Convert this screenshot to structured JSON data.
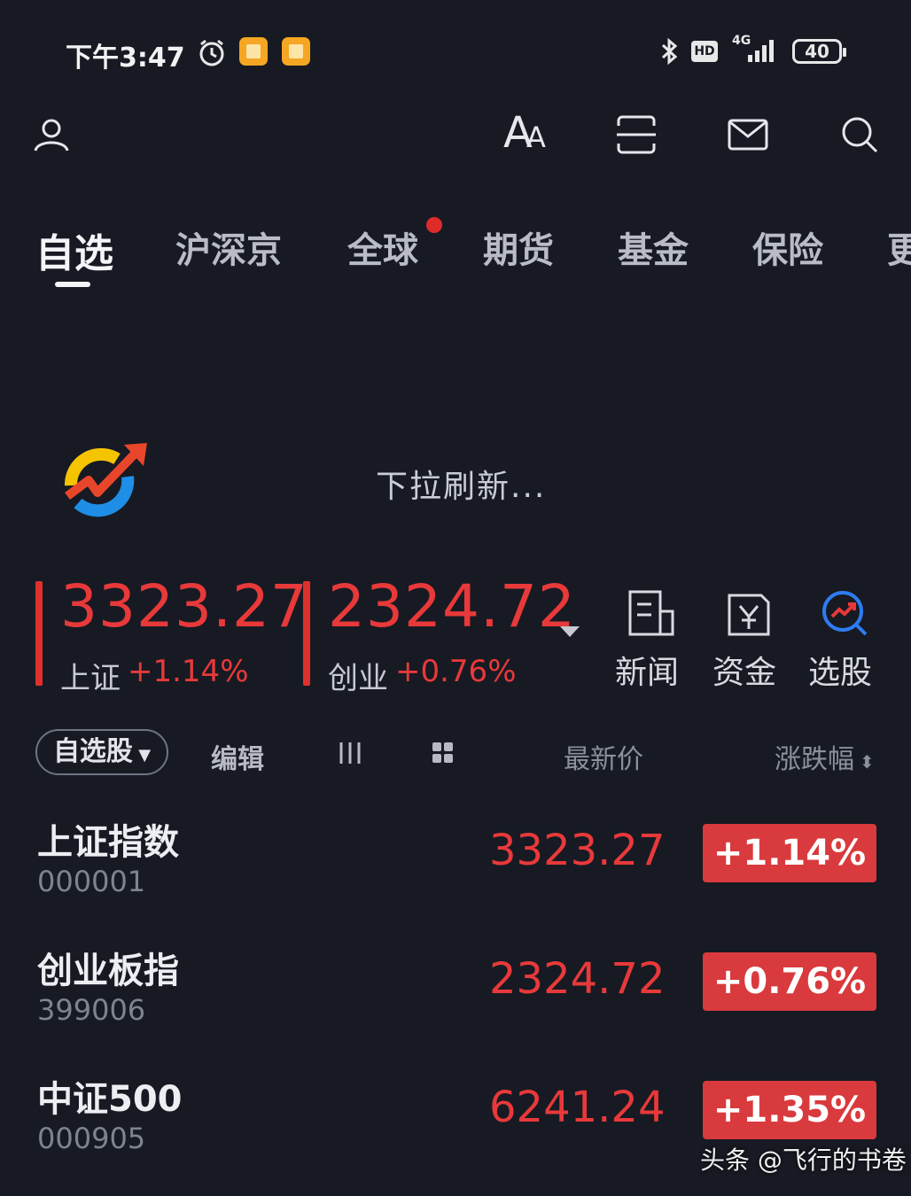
{
  "status_bar": {
    "time": "下午3:47",
    "network": "4G",
    "battery": "40",
    "hd_label": "HD"
  },
  "header": {
    "icons": [
      "user-icon",
      "font-size-icon",
      "scan-icon",
      "mail-icon",
      "search-icon"
    ],
    "font_icon_text": "A"
  },
  "tabs": [
    {
      "label": "自选",
      "active": true
    },
    {
      "label": "沪深京",
      "active": false
    },
    {
      "label": "全球",
      "active": false,
      "badge": true
    },
    {
      "label": "期货",
      "active": false
    },
    {
      "label": "基金",
      "active": false
    },
    {
      "label": "保险",
      "active": false
    },
    {
      "label": "更",
      "active": false
    }
  ],
  "refresh": {
    "text": "下拉刷新..."
  },
  "index_summary": [
    {
      "value": "3323.27",
      "name": "上证",
      "change": "+1.14%"
    },
    {
      "value": "2324.72",
      "name": "创业",
      "change": "+0.76%"
    }
  ],
  "quick_actions": [
    {
      "label": "新闻",
      "icon": "news-icon"
    },
    {
      "label": "资金",
      "icon": "fund-flow-icon"
    },
    {
      "label": "选股",
      "icon": "stock-picker-icon"
    }
  ],
  "list_header": {
    "filter": "自选股",
    "edit": "编辑",
    "latest_price": "最新价",
    "change_pct": "涨跌幅"
  },
  "rows": [
    {
      "name": "上证指数",
      "code": "000001",
      "price": "3323.27",
      "change": "+1.14%"
    },
    {
      "name": "创业板指",
      "code": "399006",
      "price": "2324.72",
      "change": "+0.76%"
    },
    {
      "name": "中证500",
      "code": "000905",
      "price": "6241.24",
      "change": "+1.35%"
    }
  ],
  "watermark": "头条 @飞行的书卷",
  "colors": {
    "background": "#171a23",
    "up_red": "#e8393a",
    "badge_red": "#d93a3d"
  }
}
